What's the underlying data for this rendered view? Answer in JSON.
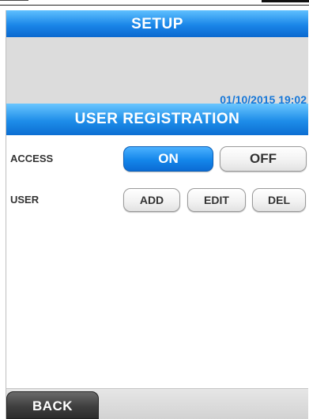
{
  "header": {
    "title": "SETUP",
    "datetime": "01/10/2015 19:02"
  },
  "section": {
    "title": "USER REGISTRATION"
  },
  "access": {
    "label": "ACCESS",
    "on_label": "ON",
    "off_label": "OFF",
    "selected": "ON"
  },
  "user": {
    "label": "USER",
    "add_label": "ADD",
    "edit_label": "EDIT",
    "del_label": "DEL"
  },
  "footer": {
    "back_label": "BACK"
  },
  "colors": {
    "accent_blue": "#1a86e8",
    "datetime_blue": "#1677d8",
    "panel_gray": "#dcdcdc",
    "back_button": "#3f3f3f"
  }
}
